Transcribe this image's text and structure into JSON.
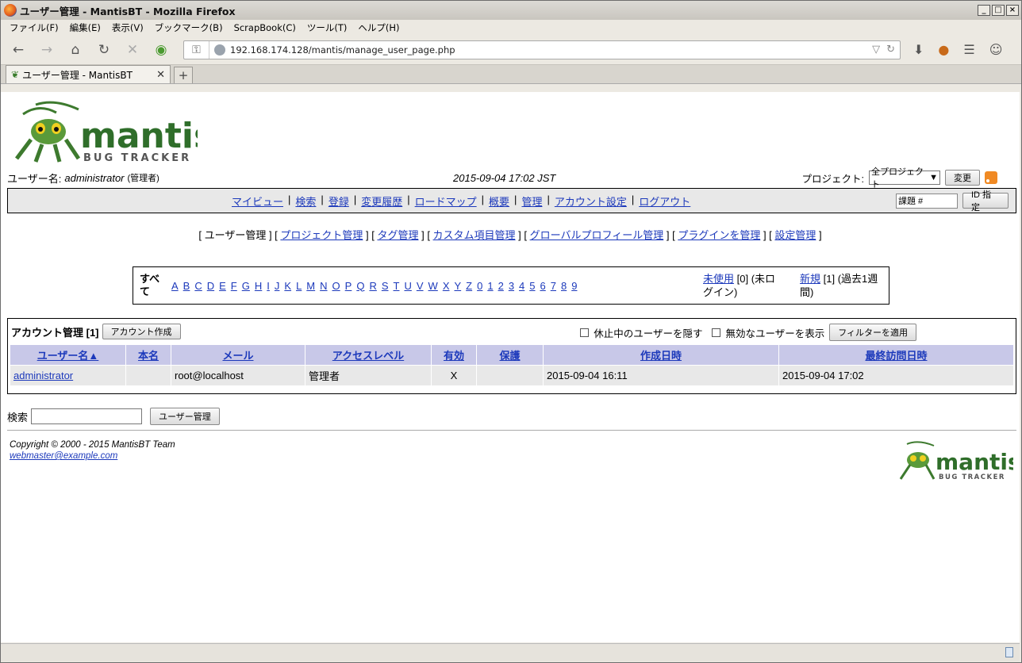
{
  "window": {
    "title": "ユーザー管理 - MantisBT - Mozilla Firefox"
  },
  "menubar": [
    "ファイル(F)",
    "編集(E)",
    "表示(V)",
    "ブックマーク(B)",
    "ScrapBook(C)",
    "ツール(T)",
    "ヘルプ(H)"
  ],
  "url": "192.168.174.128/mantis/manage_user_page.php",
  "tab": {
    "title": "ユーザー管理 - MantisBT"
  },
  "logo": {
    "word": "mantis",
    "sub": "BUG TRACKER"
  },
  "header": {
    "username_label": "ユーザー名:",
    "username": "administrator",
    "role": "(管理者)",
    "datetime": "2015-09-04 17:02 JST",
    "project_label": "プロジェクト:",
    "project_value": "全プロジェクト",
    "change_button": "変更"
  },
  "mainmenu": {
    "items": [
      "マイビュー",
      "検索",
      "登録",
      "変更履歴",
      "ロードマップ",
      "概要",
      "管理",
      "アカウント設定",
      "ログアウト"
    ],
    "jump_placeholder": "課題 #",
    "jump_button": "ID 指定"
  },
  "submenu": {
    "current": "ユーザー管理",
    "links": [
      "プロジェクト管理",
      "タグ管理",
      "カスタム項目管理",
      "グローバルプロフィール管理",
      "プラグインを管理",
      "設定管理"
    ]
  },
  "alpha": {
    "all": "すべて",
    "letters": [
      "A",
      "B",
      "C",
      "D",
      "E",
      "F",
      "G",
      "H",
      "I",
      "J",
      "K",
      "L",
      "M",
      "N",
      "O",
      "P",
      "Q",
      "R",
      "S",
      "T",
      "U",
      "V",
      "W",
      "X",
      "Y",
      "Z",
      "0",
      "1",
      "2",
      "3",
      "4",
      "5",
      "6",
      "7",
      "8",
      "9"
    ],
    "unused_link": "未使用",
    "unused_text": " [0] (未ログイン)",
    "new_link": "新規",
    "new_text": " [1] (過去1週間)"
  },
  "accounts": {
    "title": "アカウント管理 [1]",
    "create_button": "アカウント作成",
    "hide_inactive": "休止中のユーザーを隠す",
    "show_disabled": "無効なユーザーを表示",
    "apply_button": "フィルターを適用",
    "columns": [
      "ユーザー名▲",
      "本名",
      "メール",
      "アクセスレベル",
      "有効",
      "保護",
      "作成日時",
      "最終訪問日時"
    ],
    "rows": [
      [
        "administrator",
        "",
        "root@localhost",
        "管理者",
        "X",
        "",
        "2015-09-04 16:11",
        "2015-09-04 17:02"
      ]
    ]
  },
  "search": {
    "label": "検索",
    "button": "ユーザー管理"
  },
  "footer": {
    "copyright": "Copyright © 2000 - 2015 MantisBT Team",
    "email": "webmaster@example.com"
  },
  "colors": {
    "accent": "#1c39bb",
    "table_header": "#c8c8e8",
    "row_bg": "#e8e8e8",
    "logo_green": "#2f6e2a"
  }
}
